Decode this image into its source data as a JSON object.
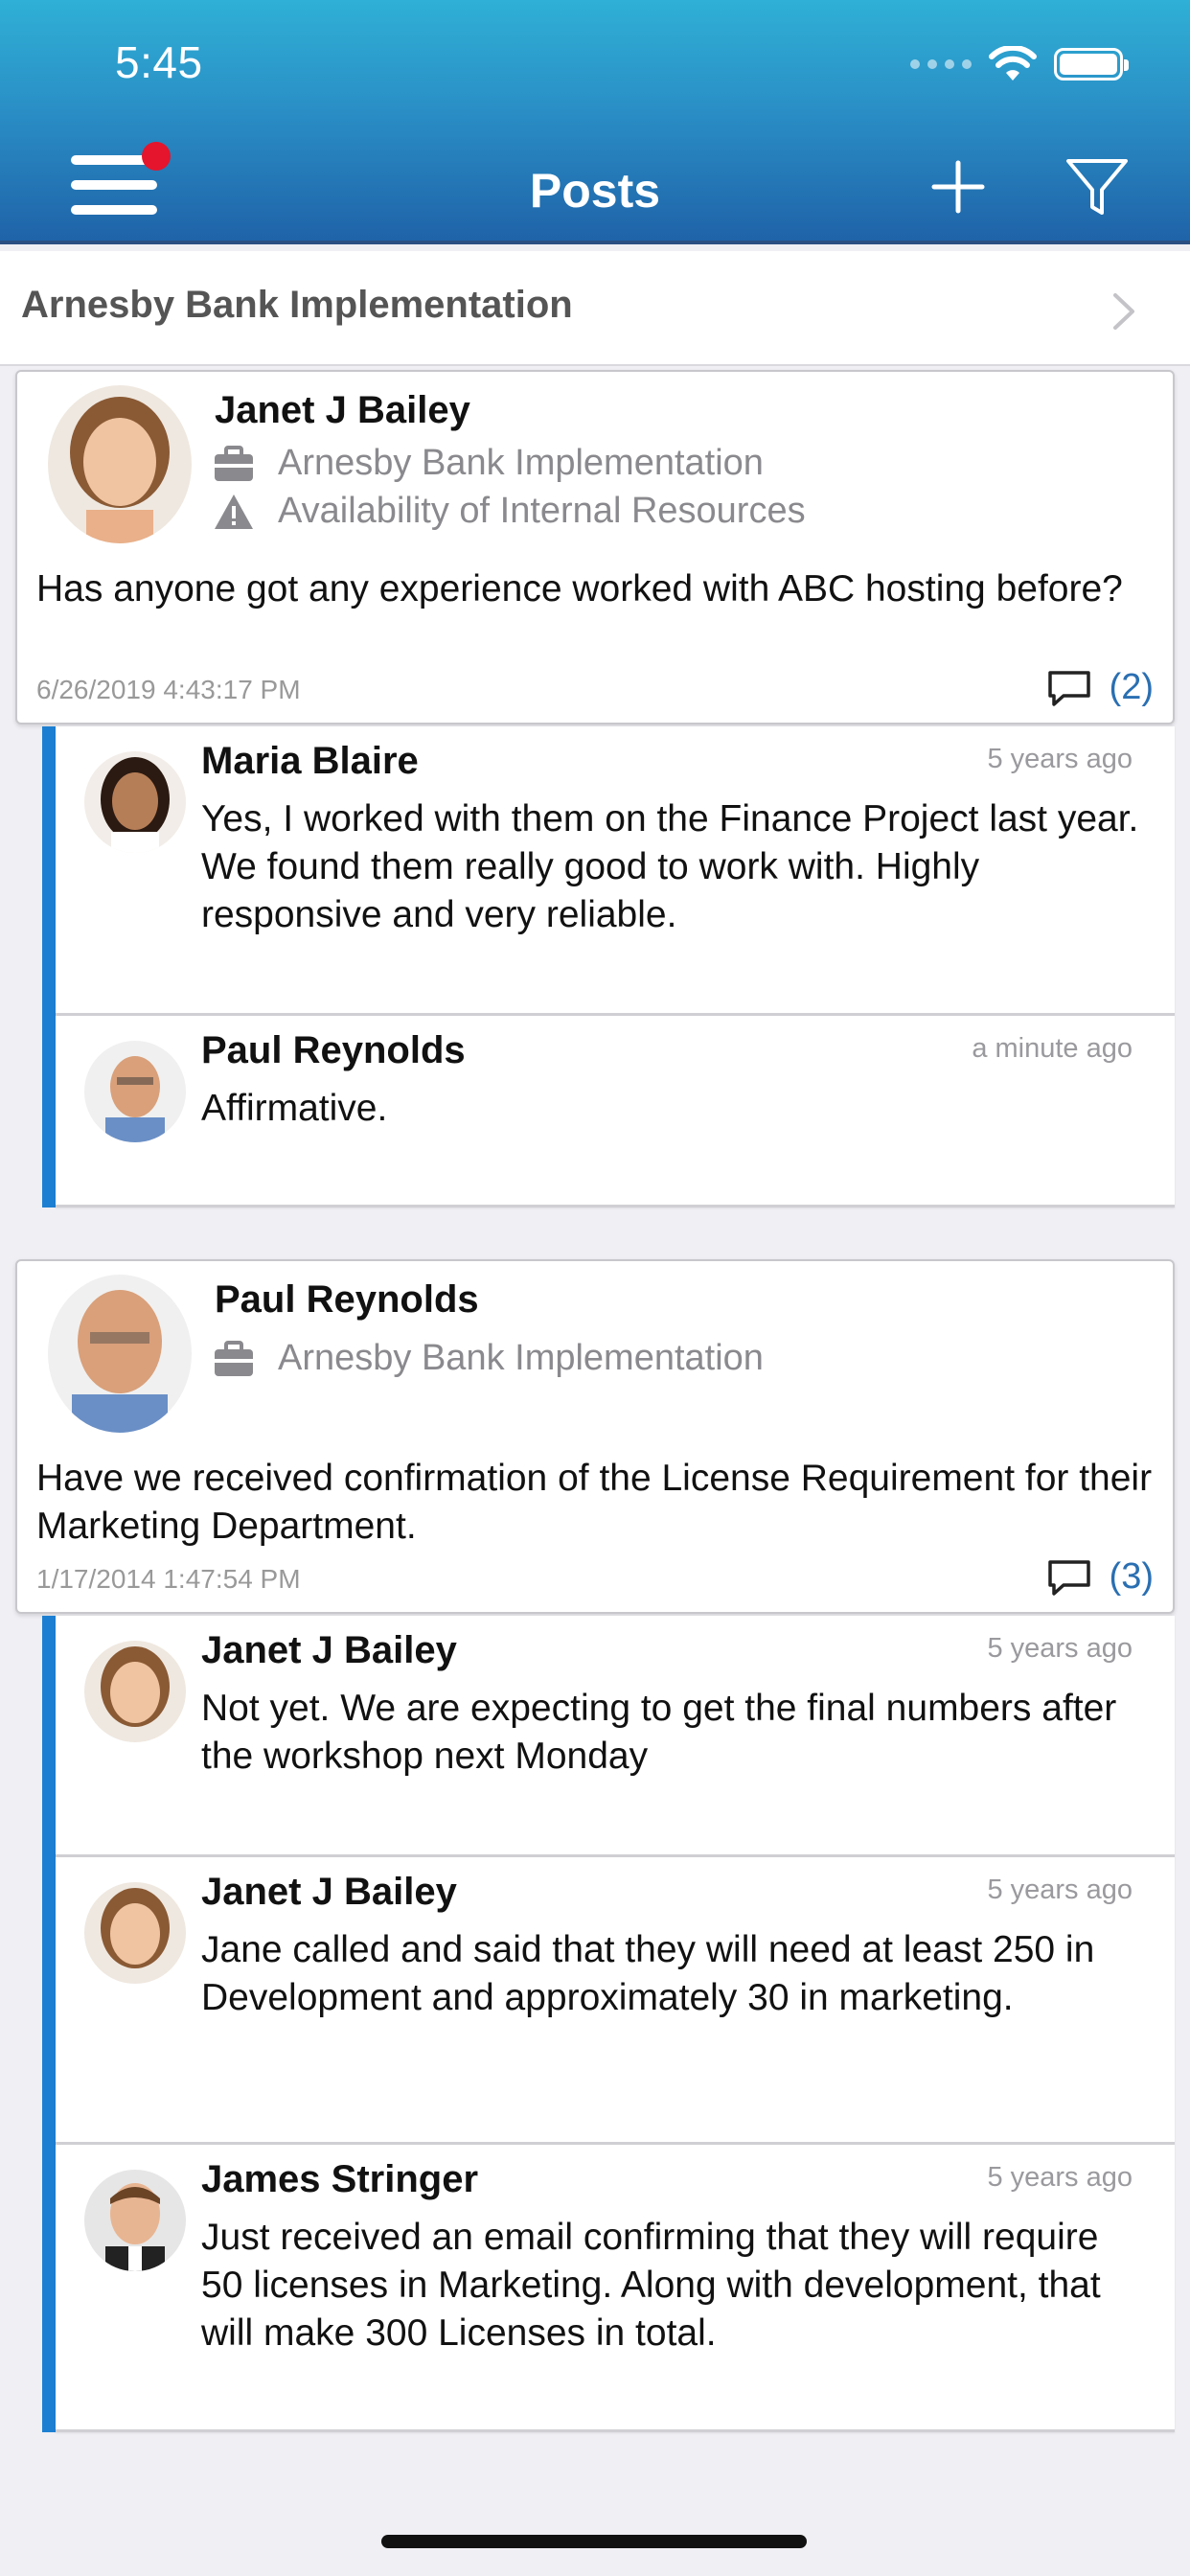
{
  "status_bar": {
    "time": "5:45"
  },
  "header": {
    "title": "Posts"
  },
  "breadcrumb": {
    "label": "Arnesby Bank Implementation"
  },
  "posts": [
    {
      "author": "Janet J Bailey",
      "project": "Arnesby Bank Implementation",
      "issue": "Availability of Internal Resources",
      "body": "Has anyone got any experience worked with ABC hosting before?",
      "date": "6/26/2019 4:43:17 PM",
      "comment_count": "(2)",
      "replies": [
        {
          "author": "Maria Blaire",
          "time": "5 years ago",
          "text": "Yes, I worked with them on the Finance Project last year.  We found them really good to work with.  Highly responsive and very reliable."
        },
        {
          "author": "Paul Reynolds",
          "time": "a minute ago",
          "text": "Affirmative."
        }
      ]
    },
    {
      "author": "Paul Reynolds",
      "project": "Arnesby Bank Implementation",
      "body": "Have we received confirmation of the License Requirement for their Marketing Department.",
      "date": "1/17/2014 1:47:54 PM",
      "comment_count": "(3)",
      "replies": [
        {
          "author": "Janet J Bailey",
          "time": "5 years ago",
          "text": "Not yet.  We are expecting to get the final numbers after the workshop next Monday"
        },
        {
          "author": "Janet J Bailey",
          "time": "5 years ago",
          "text": "Jane called and said that they will need at least 250 in Development and approximately 30 in marketing."
        },
        {
          "author": "James Stringer",
          "time": "5 years ago",
          "text": "Just received an email confirming that they will require 50 licenses in Marketing.  Along with development, that will make 300 Licenses in total."
        }
      ]
    }
  ],
  "colors": {
    "header_top": "#2fb0d6",
    "header_bottom": "#1f63a8",
    "accent": "#1d7fd1",
    "notification": "#e4152d"
  }
}
